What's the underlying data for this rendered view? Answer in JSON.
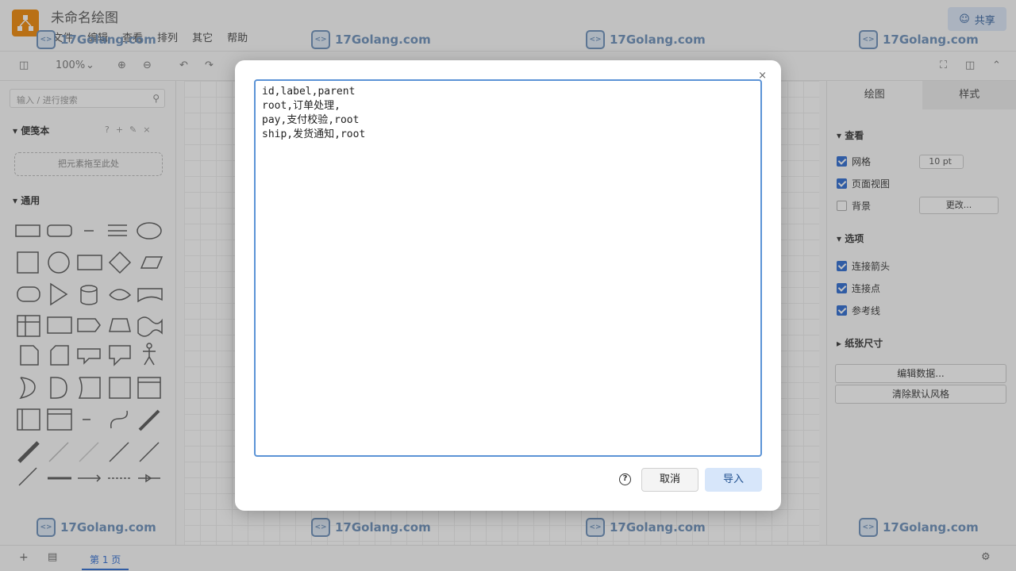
{
  "app": {
    "title": "未命名绘图",
    "share_label": "共享"
  },
  "menu": [
    "文件",
    "编辑",
    "查看",
    "排列",
    "其它",
    "帮助"
  ],
  "toolbar": {
    "zoom": "100%"
  },
  "sidebar": {
    "search_placeholder": "输入 / 进行搜索",
    "scratchpad_title": "便笺本",
    "scratchpad_drop": "把元素拖至此处",
    "general_title": "通用"
  },
  "format_panel": {
    "tabs": [
      "绘图",
      "样式"
    ],
    "view_title": "查看",
    "grid_label": "网格",
    "grid_size": "10 pt",
    "page_view_label": "页面视图",
    "background_label": "背景",
    "change_label": "更改...",
    "options_title": "选项",
    "connection_arrows_label": "连接箭头",
    "connection_points_label": "连接点",
    "guides_label": "参考线",
    "paper_size_title": "纸张尺寸",
    "edit_data_label": "编辑数据...",
    "clear_default_style_label": "清除默认风格"
  },
  "bottom": {
    "page_label": "第 1 页"
  },
  "watermark": {
    "text": "17Golang.com",
    "badge": "<>"
  },
  "dialog": {
    "close_label": "×",
    "csv_text": "id,label,parent\nroot,订单处理,\npay,支付校验,root\nship,发货通知,root",
    "help_label": "?",
    "cancel_label": "取消",
    "import_label": "导入"
  }
}
